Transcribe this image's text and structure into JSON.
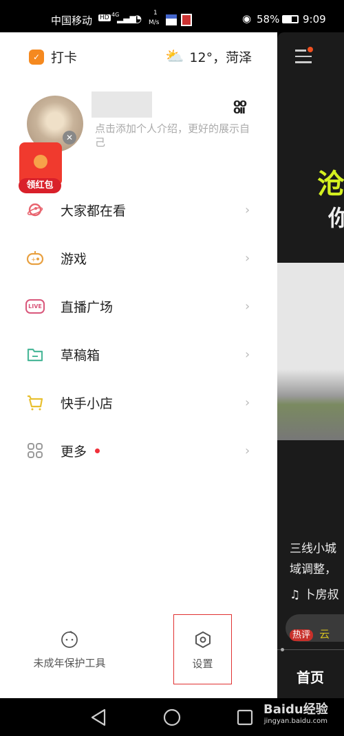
{
  "status_bar": {
    "carrier": "中国移动",
    "network": "4G",
    "speed_value": "1",
    "speed_unit": "M/s",
    "battery": "58%",
    "time": "9:09"
  },
  "drawer": {
    "checkin_label": "打卡",
    "weather": "12°，菏泽",
    "profile": {
      "bio_placeholder": "点击添加个人介绍，更好的展示自己"
    },
    "red_packet_label": "领红包",
    "menu": [
      {
        "label": "大家都在看",
        "icon": "planet-icon",
        "color": "#e8646f"
      },
      {
        "label": "游戏",
        "icon": "gamepad-icon",
        "color": "#e8a040"
      },
      {
        "label": "直播广场",
        "icon": "live-icon",
        "color": "#d9567a",
        "icon_text": "LIVE"
      },
      {
        "label": "草稿箱",
        "icon": "folder-icon",
        "color": "#4cb89a"
      },
      {
        "label": "快手小店",
        "icon": "cart-icon",
        "color": "#e8c030"
      },
      {
        "label": "更多",
        "icon": "grid-icon",
        "color": "#999999",
        "badge_dot": true
      }
    ],
    "footer": {
      "minor_protection": "未成年保护工具",
      "settings": "设置"
    }
  },
  "background_feed": {
    "headline_1": "沧",
    "headline_2": "你",
    "caption_1": "三线小城",
    "caption_2": "域调整，",
    "music": "卜房叔",
    "tag": "热评",
    "tag_text": "云",
    "tab": "首页"
  },
  "watermark": {
    "brand": "Baidu经验",
    "url": "jingyan.baidu.com"
  }
}
